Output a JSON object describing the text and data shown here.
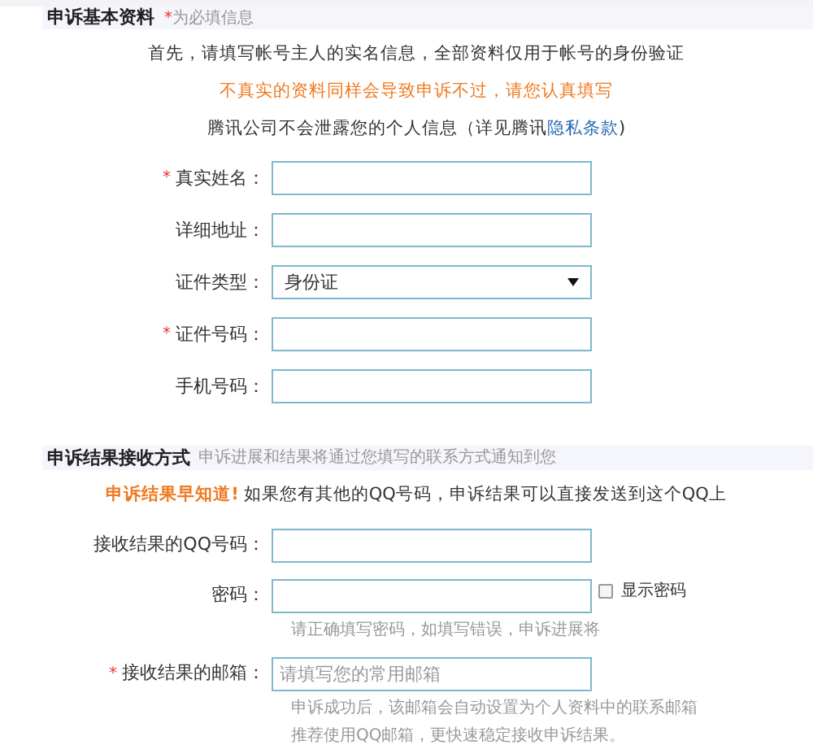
{
  "section_basic": {
    "title": "申诉基本资料",
    "note_mark": "*",
    "note": "为必填信息"
  },
  "intro": {
    "line_1": "首先，请填写帐号主人的实名信息，全部资料仅用于帐号的身份验证",
    "warning": "不真实的资料同样会导致申诉不过，请您认真填写",
    "privacy_text": "腾讯公司不会泄露您的个人信息（详见腾讯",
    "privacy_link": "隐私条款",
    "privacy_end": ")"
  },
  "fields": [
    {
      "kind": "input",
      "label": "真实姓名：",
      "required": true
    },
    {
      "kind": "input",
      "label": "详细地址：",
      "required": false
    },
    {
      "kind": "select",
      "label": "证件类型：",
      "required": false,
      "value": "身份证"
    },
    {
      "kind": "input",
      "label": "证件号码：",
      "required": true
    },
    {
      "kind": "input",
      "label": "手机号码：",
      "required": false
    }
  ],
  "section_result": {
    "title": "申诉结果接收方式",
    "note": "申诉进展和结果将通过您填写的联系方式通知到您"
  },
  "tip": {
    "highlight": "申诉结果早知道!",
    "text": "如果您有其他的QQ号码，申诉结果可以直接发送到这个QQ上"
  },
  "result_fields": [
    {
      "kind": "input",
      "label": "接收结果的QQ号码：",
      "required": false
    },
    {
      "kind": "input",
      "label": "密码：",
      "required": false,
      "show_password": {
        "label": "显示密码",
        "checked": false
      },
      "hints": [
        "请正确填写密码，如填写错误，申诉进展将"
      ]
    },
    {
      "kind": "input",
      "label": "接收结果的邮箱：",
      "required": true,
      "placeholder": "请填写您的常用邮箱",
      "hints": [
        "申诉成功后，该邮箱会自动设置为个人资料中的联系邮箱",
        "推荐使用QQ邮箱，更快速稳定接收申诉结果。"
      ]
    }
  ]
}
